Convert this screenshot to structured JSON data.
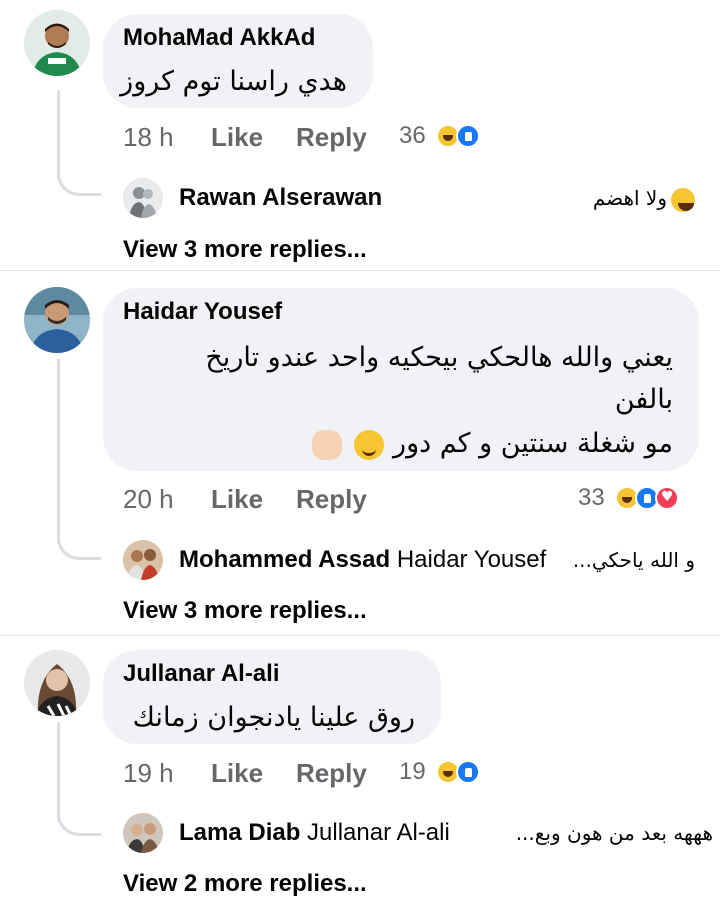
{
  "labels": {
    "like": "Like",
    "reply": "Reply"
  },
  "comments": [
    {
      "author": "MohaMad AkkAd",
      "lines": [
        "هدي راسنا توم كروز"
      ],
      "time": "18 h",
      "reaction_count": "36",
      "reactions": [
        "haha",
        "like"
      ],
      "preview_reply": {
        "author": "Rawan Alserawan",
        "tag": "",
        "snippet": "ولا اهضم",
        "emoji": "haha"
      },
      "view_more": "View 3 more replies..."
    },
    {
      "author": "Haidar Yousef",
      "lines": [
        "يعني والله هالحكي بيحكيه واحد عندو تاريخ",
        "بالفن",
        "مو شغلة سنتين و كم دور"
      ],
      "time": "20 h",
      "reaction_count": "33",
      "reactions": [
        "haha",
        "like",
        "love"
      ],
      "preview_reply": {
        "author": "Mohammed Assad",
        "tag": "Haidar Yousef",
        "snippet": "و الله ياحكي...",
        "emoji": ""
      },
      "view_more": "View 3 more replies..."
    },
    {
      "author": "Jullanar Al-ali",
      "lines": [
        "روق علينا يادنجوان زمانك"
      ],
      "time": "19 h",
      "reaction_count": "19",
      "reactions": [
        "haha",
        "like"
      ],
      "preview_reply": {
        "author": "Lama Diab",
        "tag": "Jullanar Al-ali",
        "snippet": "هههه بعد من هون وبع...",
        "emoji": ""
      },
      "view_more": "View 2 more replies..."
    }
  ],
  "colors": {
    "bubble": "#f0f2f5",
    "meta_text": "#65676b",
    "like_blue": "#1877f2",
    "haha_yellow": "#f7c532",
    "love_red": "#f33e58"
  }
}
